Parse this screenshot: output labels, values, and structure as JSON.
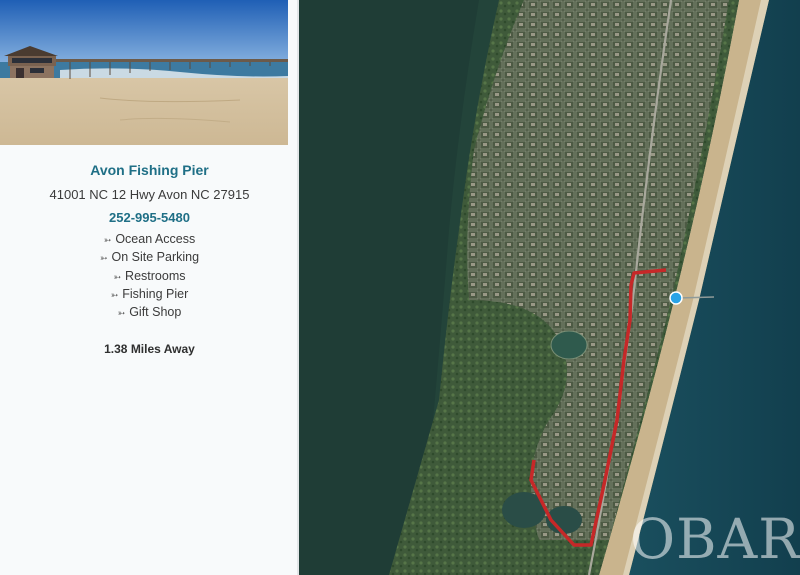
{
  "listing": {
    "name": "Avon Fishing Pier",
    "address": "41001 NC 12 Hwy Avon NC 27915",
    "phone": "252-995-5480",
    "amenities": [
      {
        "icon": "arrow-right-icon",
        "arrow": "➳",
        "label": "Ocean Access"
      },
      {
        "icon": "arrow-right-icon",
        "arrow": "➳",
        "label": "On Site Parking"
      },
      {
        "icon": "arrow-right-icon",
        "arrow": "➳",
        "label": "Restrooms"
      },
      {
        "icon": "arrow-right-icon",
        "arrow": "➳",
        "label": "Fishing Pier"
      },
      {
        "icon": "arrow-right-icon",
        "arrow": "➳",
        "label": "Gift Shop"
      }
    ],
    "distance": "1.38 Miles Away"
  },
  "map": {
    "route_color": "#c62828",
    "destination_marker_color": "#29a3e6",
    "watermark": "OBAR"
  }
}
